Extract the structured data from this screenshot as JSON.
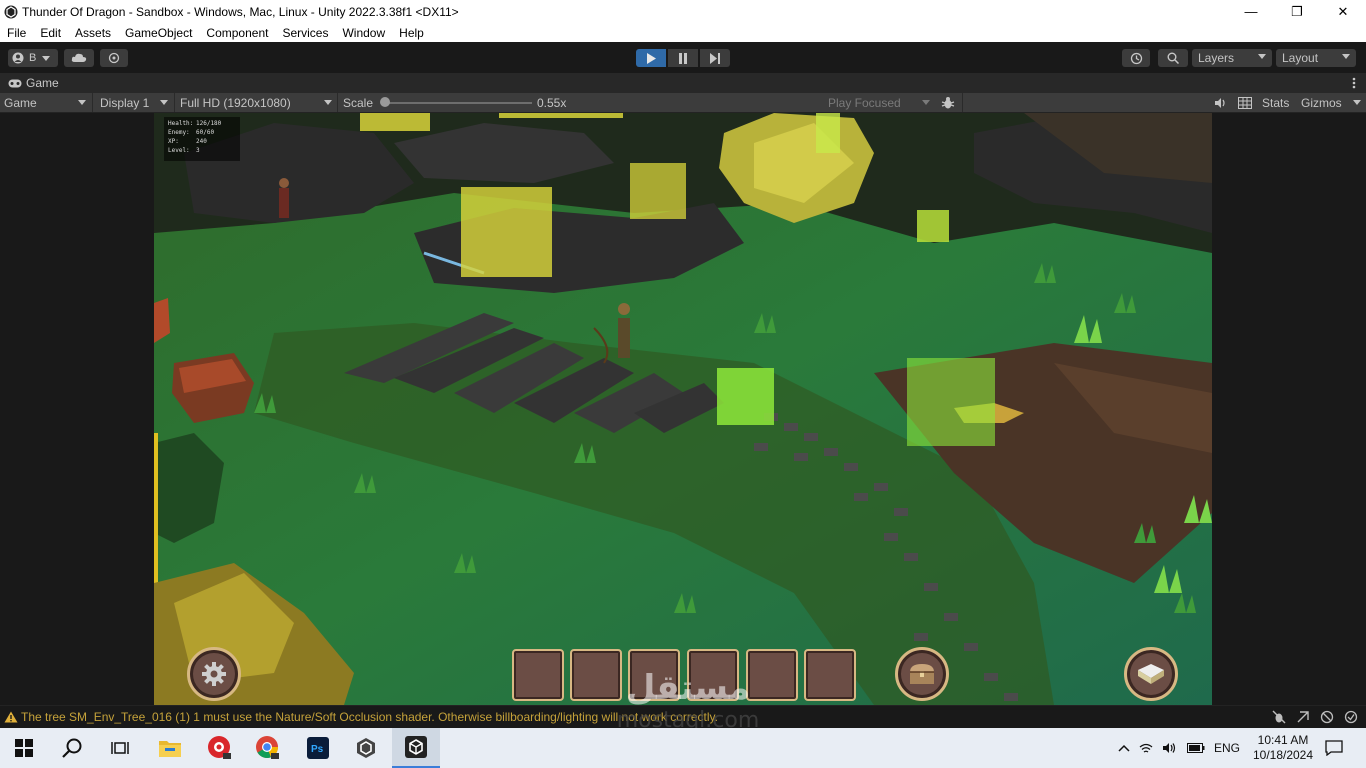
{
  "window": {
    "title": "Thunder Of Dragon - Sandbox - Windows, Mac, Linux - Unity 2022.3.38f1 <DX11>",
    "minimize": "—",
    "maximize": "❐",
    "close": "✕"
  },
  "menu": [
    "File",
    "Edit",
    "Assets",
    "GameObject",
    "Component",
    "Services",
    "Window",
    "Help"
  ],
  "toolbar": {
    "account_label": "B",
    "layers_label": "Layers",
    "layout_label": "Layout",
    "accent": "#2f6aa8"
  },
  "tab": {
    "label": "Game"
  },
  "gamebar": {
    "mode": "Game",
    "display": "Display 1",
    "resolution": "Full HD (1920x1080)",
    "scale_label": "Scale",
    "scale_value": "0.55x",
    "play_focused": "Play Focused",
    "stats": "Stats",
    "gizmos": "Gizmos"
  },
  "hud": [
    {
      "k": "Health:",
      "v": "126/180"
    },
    {
      "k": "Enemy:",
      "v": "60/60"
    },
    {
      "k": "XP:",
      "v": "240"
    },
    {
      "k": "Level:",
      "v": "3"
    }
  ],
  "status": {
    "message": "The tree SM_Env_Tree_016 (1) 1 must use the Nature/Soft Occlusion shader. Otherwise billboarding/lighting will not work correctly."
  },
  "watermark": {
    "arabic": "مستقل",
    "latin": "mostaql.com"
  },
  "taskbar": {
    "lang": "ENG",
    "time": "10:41 AM",
    "date": "10/18/2024"
  }
}
